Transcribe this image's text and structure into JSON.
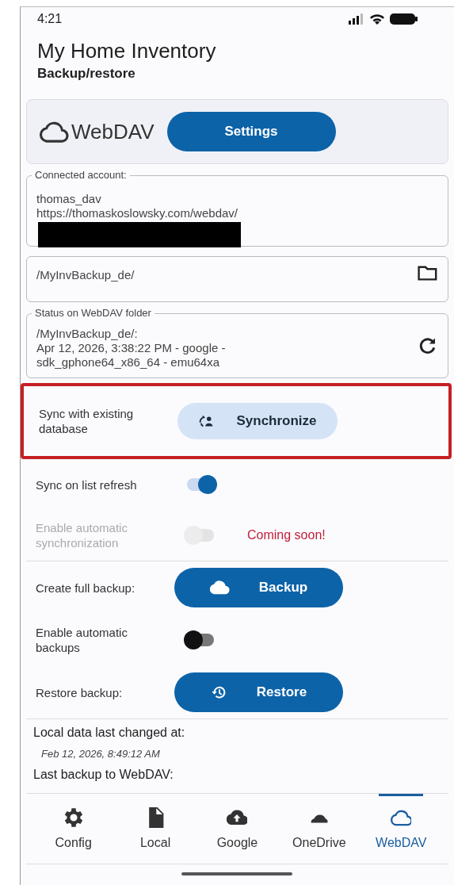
{
  "status_bar": {
    "time": "4:21"
  },
  "app_bar": {
    "title": "My Home Inventory",
    "subtitle": "Backup/restore"
  },
  "service": {
    "name": "WebDAV",
    "button": "Settings"
  },
  "fields": [
    {
      "label": "Connected account:",
      "lines": [
        "thomas_dav",
        "https://thomaskoslowsky.com/webdav/"
      ],
      "redacted": true
    },
    {
      "lines": [
        "/MyInvBackup_de/"
      ]
    },
    {
      "label": "Status on WebDAV folder",
      "lines": [
        "/MyInvBackup_de/:",
        "Apr 12, 2026, 3:38:22 PM - google -",
        "sdk_gphone64_x86_64 - emu64xa"
      ]
    }
  ],
  "sync_rows": [
    {
      "kind": "button",
      "label": "Sync with existing database",
      "button": "Synchronize",
      "highlighted": true
    },
    {
      "kind": "switch",
      "label": "Sync on list refresh",
      "on": true,
      "disabled": false
    },
    {
      "kind": "switch",
      "label": "Enable automatic synchronization",
      "on": false,
      "disabled": true,
      "note": "Coming soon!"
    }
  ],
  "backup_rows": [
    {
      "kind": "button",
      "label": "Create full backup:",
      "button": "Backup"
    },
    {
      "kind": "switch",
      "label": "Enable automatic backups",
      "on": false,
      "disabled": false
    },
    {
      "kind": "button",
      "label": "Restore backup:",
      "button": "Restore"
    }
  ],
  "info": [
    {
      "kind": "heading",
      "text": "Local data last changed at:"
    },
    {
      "kind": "value",
      "text": "Feb 12, 2026, 8:49:12 AM"
    },
    {
      "kind": "heading",
      "text": "Last backup to WebDAV:"
    }
  ],
  "nav": [
    {
      "label": "Config",
      "selected": false
    },
    {
      "label": "Local",
      "selected": false
    },
    {
      "label": "Google",
      "selected": false
    },
    {
      "label": "OneDrive",
      "selected": false
    },
    {
      "label": "WebDAV",
      "selected": true
    }
  ]
}
